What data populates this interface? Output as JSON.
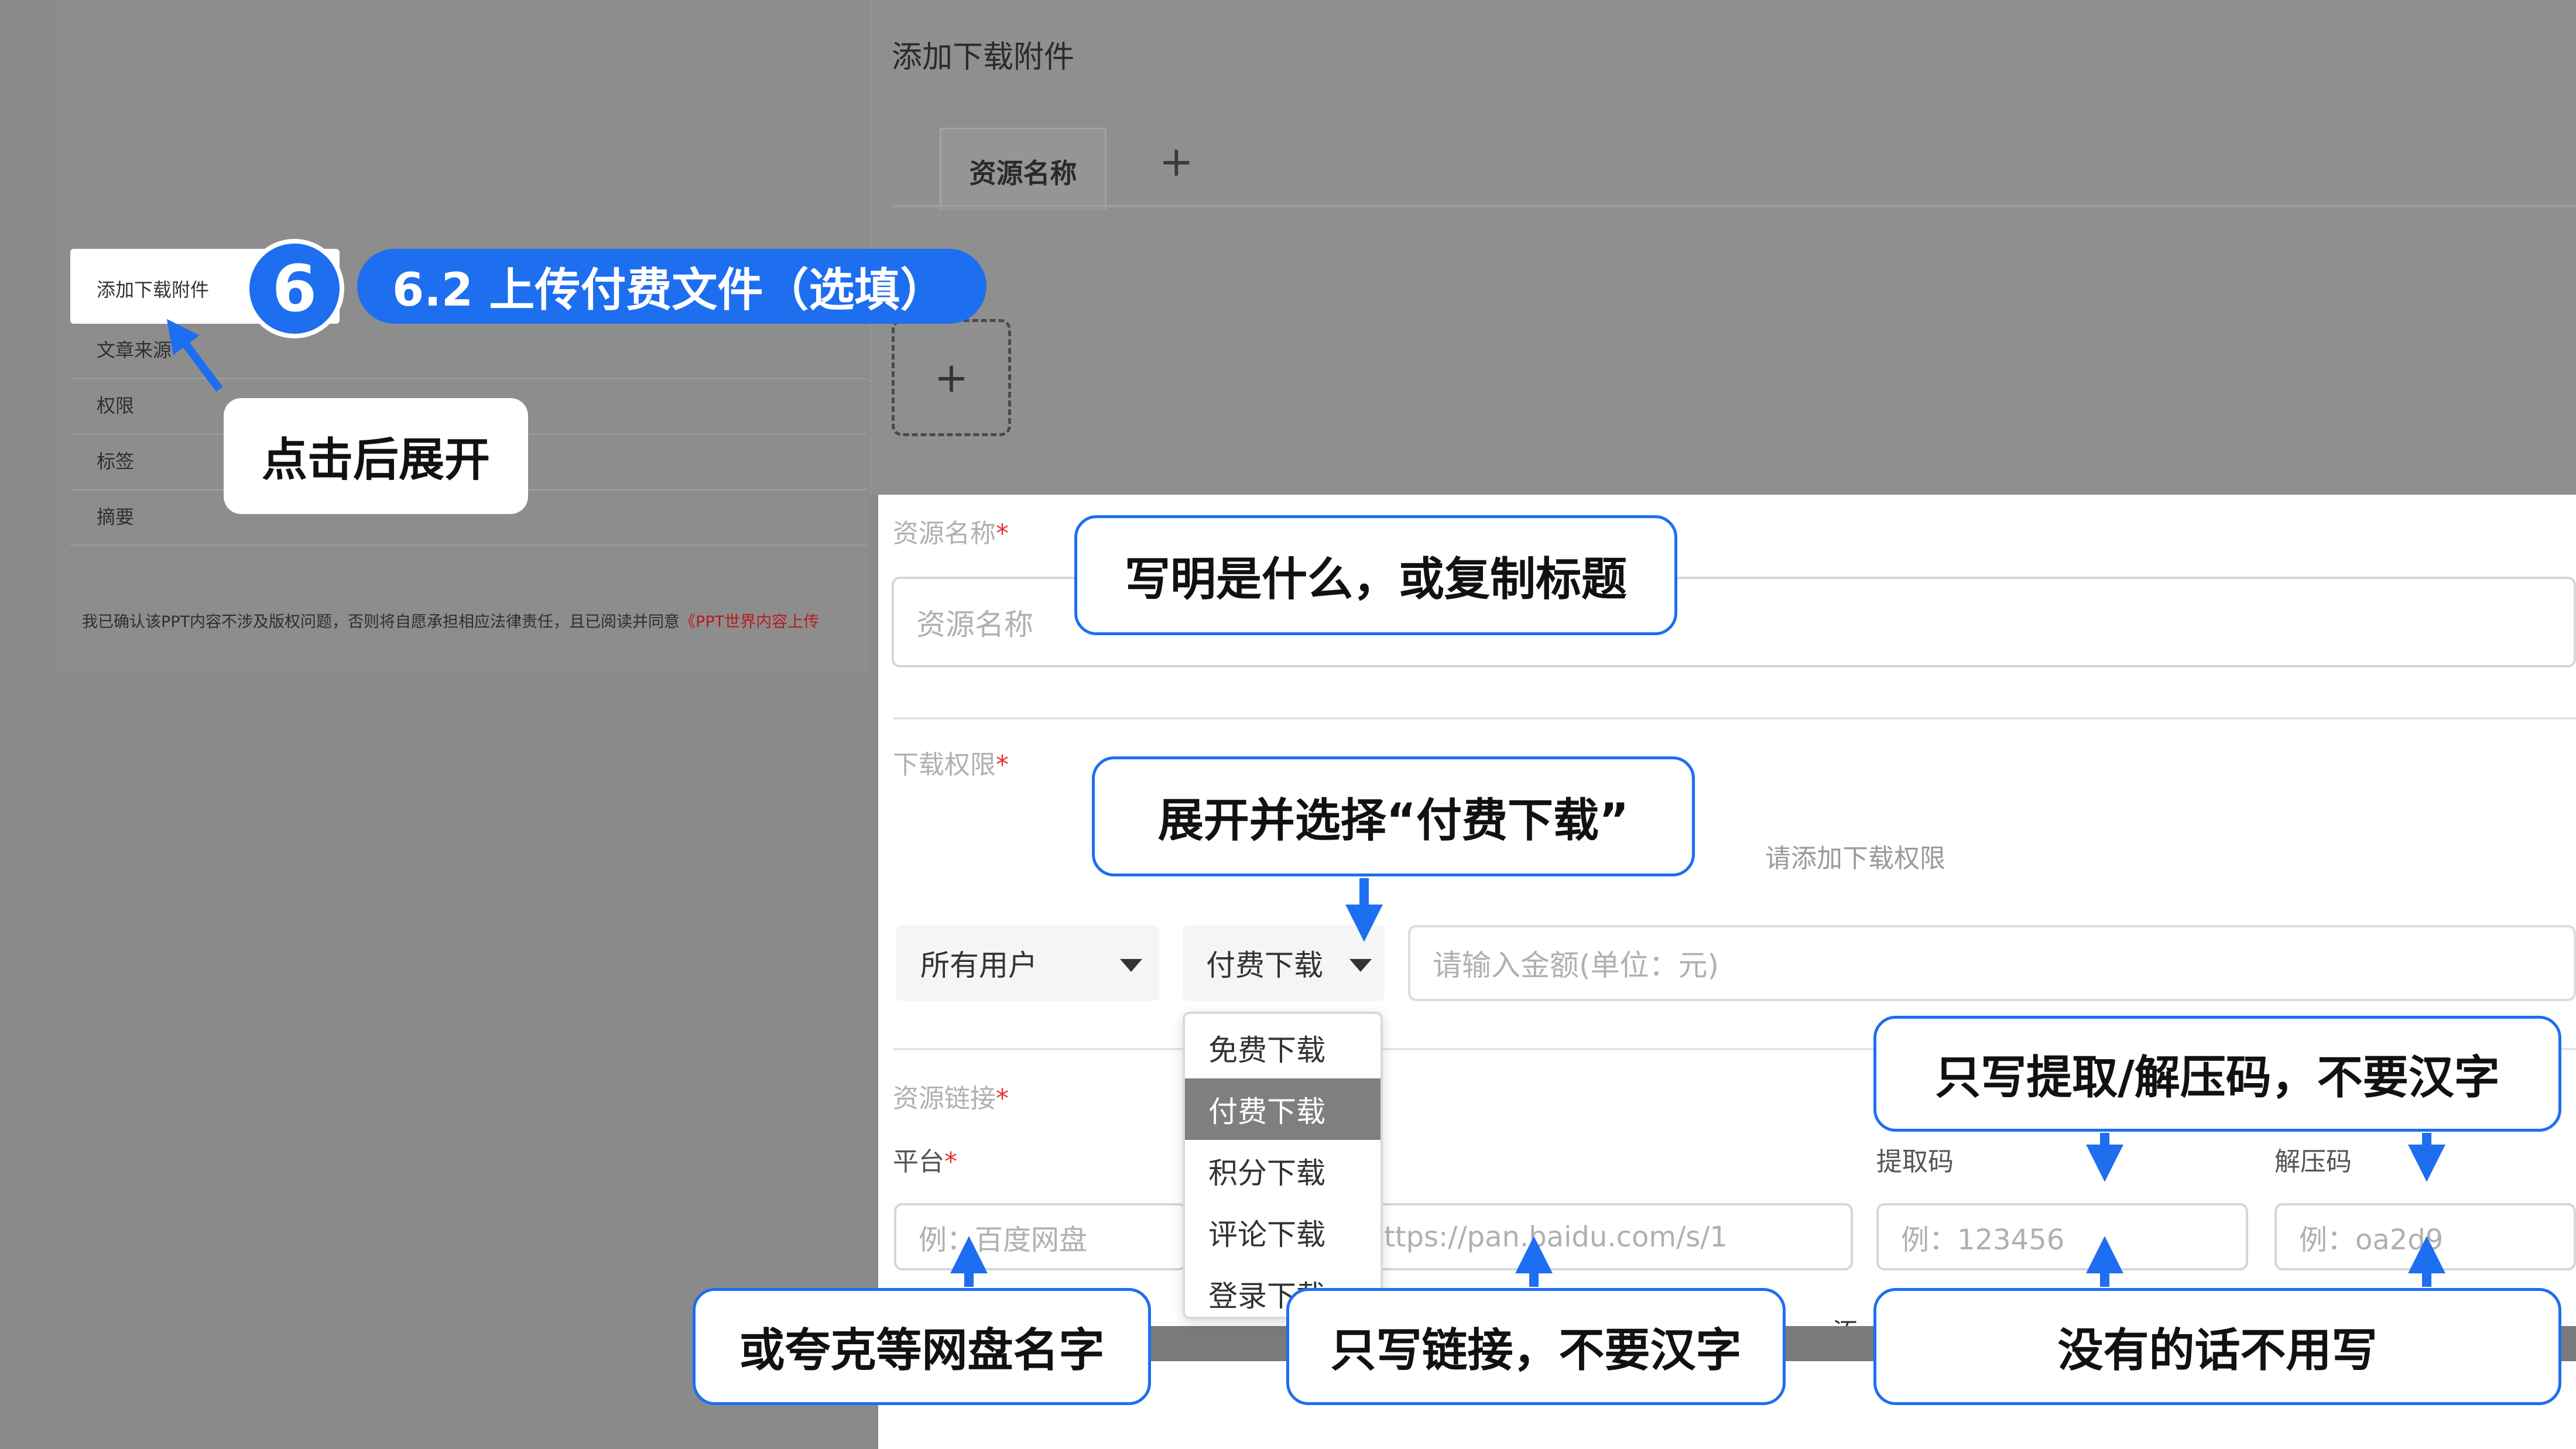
{
  "background": {
    "section_title": "添加下载附件",
    "menu": [
      "文章来源",
      "权限",
      "标签",
      "摘要"
    ],
    "menu_highlight_label": "添加下载附件",
    "confirm_prefix": "我已确认该PPT内容不涉及版权问题，否则将自愿承担相应法律责任，且已阅读并同意",
    "confirm_link": "《PPT世界内容上传",
    "tab_label": "资源名称",
    "tab_add": "+",
    "upload_plus": "+"
  },
  "step": {
    "number": "6",
    "title": "6.2 上传付费文件（选填）"
  },
  "form": {
    "resource_name_label": "资源名称",
    "resource_name_placeholder": "资源名称",
    "download_perm_label": "下载权限",
    "add_perm_hint": "请添加下载权限",
    "user_select": "所有用户",
    "type_select": "付费下载",
    "amount_placeholder": "请输入金额(单位：元)",
    "dropdown_options": [
      "免费下载",
      "付费下载",
      "积分下载",
      "评论下载",
      "登录下载"
    ],
    "dropdown_selected_index": 1,
    "resource_link_label": "资源链接",
    "platform_label": "平台",
    "platform_placeholder": "例：百度网盘",
    "link_placeholder": "ttps://pan.baidu.com/s/1",
    "extract_code_label": "提取码",
    "extract_code_placeholder": "例：123456",
    "unzip_code_label": "解压码",
    "unzip_code_placeholder": "例：oa2d9",
    "required_mark": "*",
    "partial_text": "添"
  },
  "callouts": {
    "click_expand": "点击后展开",
    "write_name": "写明是什么，或复制标题",
    "expand_select": "展开并选择“付费下载”",
    "only_code": "只写提取/解压码，不要汉字",
    "platform_name": "或夸克等网盘名字",
    "only_link": "只写链接，不要汉字",
    "no_need": "没有的话不用写"
  },
  "colors": {
    "accent": "#1e6ef0",
    "required": "#e3342f",
    "overlay_bg": "#8a8a8a"
  }
}
